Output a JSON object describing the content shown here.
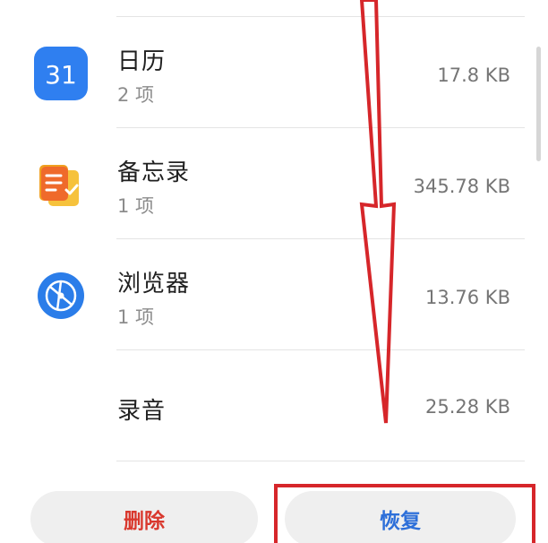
{
  "apps": [
    {
      "name": "日历",
      "count": "2 项",
      "size": "17.8 KB",
      "icon": "calendar-icon",
      "icon_text": "31"
    },
    {
      "name": "备忘录",
      "count": "1 项",
      "size": "345.78 KB",
      "icon": "notes-icon"
    },
    {
      "name": "浏览器",
      "count": "1 项",
      "size": "13.76 KB",
      "icon": "browser-icon"
    },
    {
      "name": "录音",
      "size": "25.28 KB",
      "icon": "recorder-icon"
    }
  ],
  "actions": {
    "delete_label": "删除",
    "restore_label": "恢复"
  },
  "colors": {
    "delete": "#d9382d",
    "restore": "#2d6fd9",
    "annotation": "#d6262a",
    "calendar": "#2f7ff0"
  }
}
